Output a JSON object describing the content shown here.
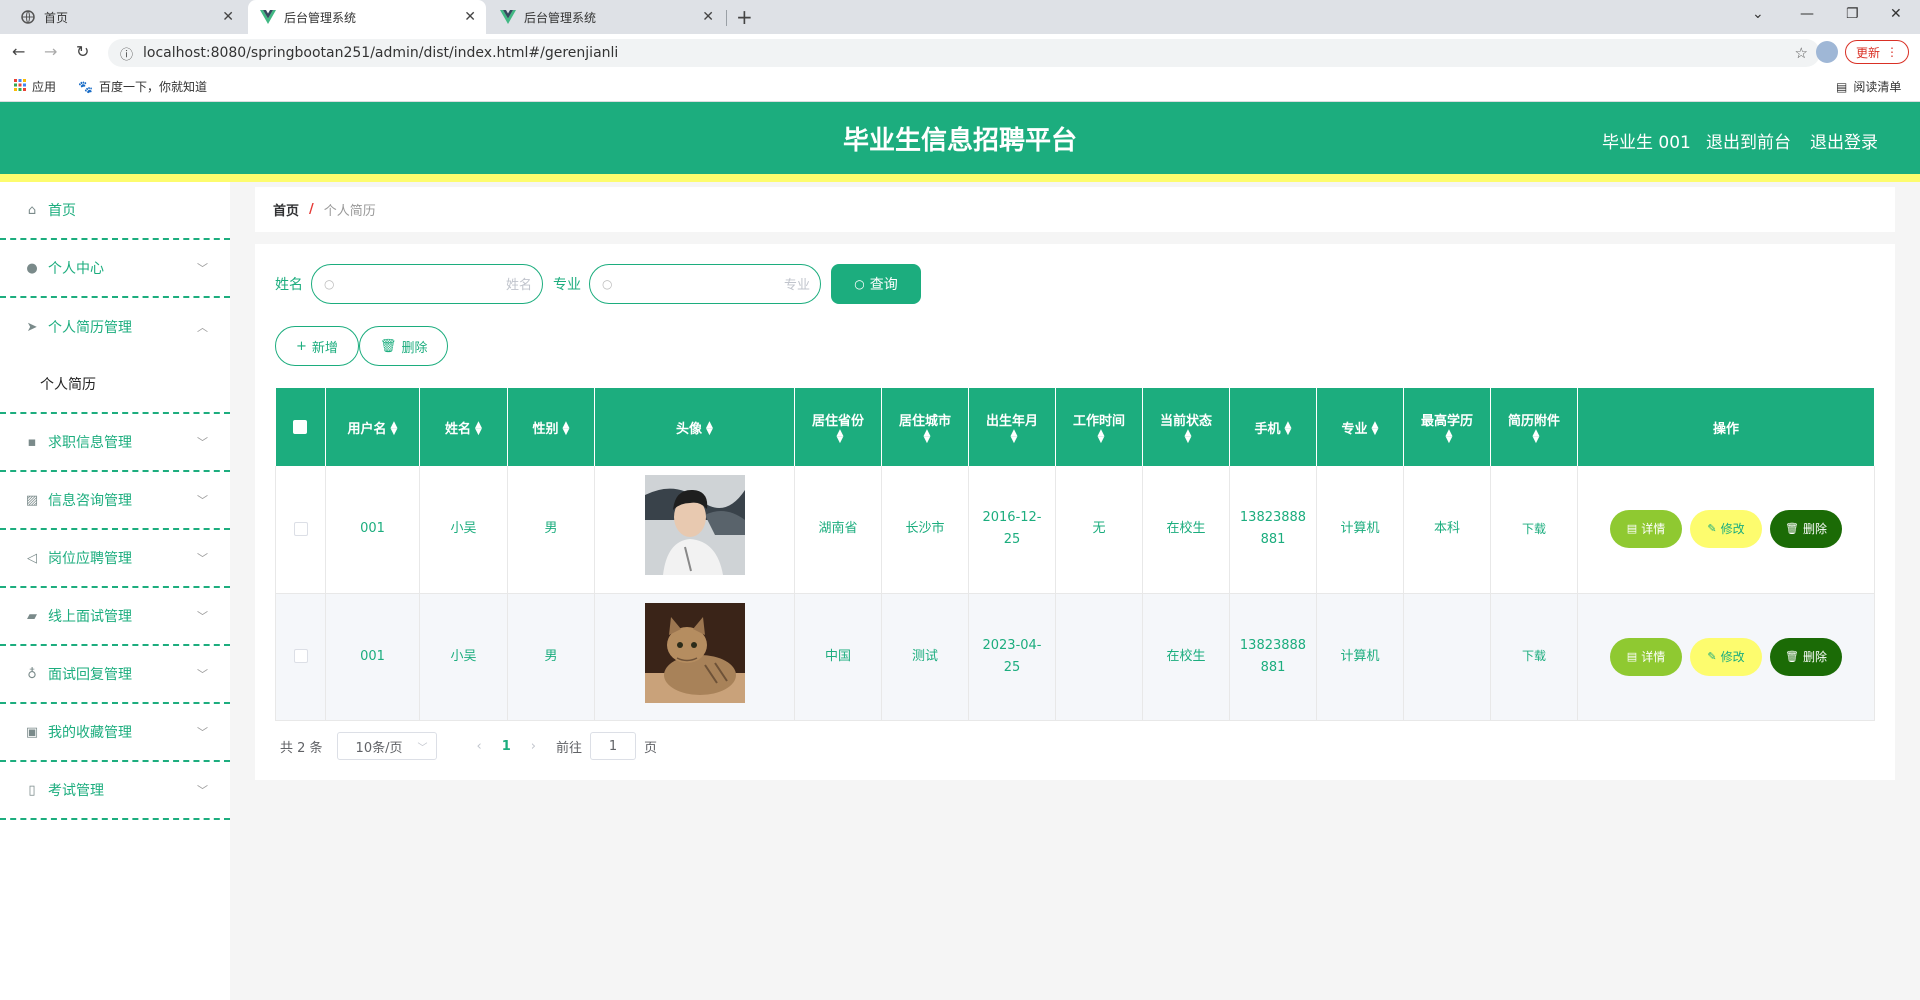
{
  "browser": {
    "tabs": [
      {
        "label": "首页"
      },
      {
        "label": "后台管理系统"
      },
      {
        "label": "后台管理系统"
      }
    ],
    "url": "localhost:8080/springbootan251/admin/dist/index.html#/gerenjianli",
    "update_label": "更新",
    "bookmarks": [
      {
        "label": "应用"
      },
      {
        "label": "百度一下，你就知道"
      },
      {
        "label": "阅读清单"
      }
    ]
  },
  "header": {
    "title": "毕业生信息招聘平台",
    "user": "毕业生 001",
    "to_front": "退出到前台",
    "logout": "退出登录"
  },
  "sidebar": {
    "items": [
      {
        "label": "首页",
        "icon": "home-icon"
      },
      {
        "label": "个人中心",
        "icon": "user-icon"
      },
      {
        "label": "个人简历管理",
        "icon": "send-icon"
      },
      {
        "label": "求职信息管理",
        "icon": "chat-icon"
      },
      {
        "label": "信息咨询管理",
        "icon": "chart-icon"
      },
      {
        "label": "岗位应聘管理",
        "icon": "position-icon"
      },
      {
        "label": "线上面试管理",
        "icon": "wallet-icon"
      },
      {
        "label": "面试回复管理",
        "icon": "microphone-icon"
      },
      {
        "label": "我的收藏管理",
        "icon": "suitcase-icon"
      },
      {
        "label": "考试管理",
        "icon": "phone-icon"
      }
    ],
    "submenu_label": "个人简历"
  },
  "breadcrumb": {
    "home": "首页",
    "sep": "/",
    "current": "个人简历"
  },
  "search": {
    "name_label": "姓名",
    "name_placeholder": "姓名",
    "major_label": "专业",
    "major_placeholder": "专业",
    "query_label": "查询"
  },
  "actions": {
    "add_label": "新增",
    "delete_label": "删除"
  },
  "table": {
    "columns": [
      "用户名",
      "姓名",
      "性别",
      "头像",
      "居住省份",
      "居住城市",
      "出生年月",
      "工作时间",
      "当前状态",
      "手机",
      "专业",
      "最高学历",
      "简历附件",
      "操作"
    ],
    "rows": [
      {
        "username": "001",
        "name": "小吴",
        "gender": "男",
        "province": "湖南省",
        "city": "长沙市",
        "birth_a": "2016-12-",
        "birth_b": "25",
        "work_time": "无",
        "status": "在校生",
        "phone_a": "13823888",
        "phone_b": "881",
        "major": "计算机",
        "education": "本科",
        "attachment": "下载"
      },
      {
        "username": "001",
        "name": "小吴",
        "gender": "男",
        "province": "中国",
        "city": "测试",
        "birth_a": "2023-04-",
        "birth_b": "25",
        "work_time": "",
        "status": "在校生",
        "phone_a": "13823888",
        "phone_b": "881",
        "major": "计算机",
        "education": "",
        "attachment": "下载"
      }
    ],
    "op_detail": "详情",
    "op_edit": "修改",
    "op_delete": "删除"
  },
  "pager": {
    "total": "共 2 条",
    "page_size": "10条/页",
    "current": "1",
    "goto_label": "前往",
    "goto_value": "1",
    "page_suffix": "页"
  },
  "colors": {
    "primary": "#1cad7e",
    "accent_yellow": "#fdfc6e",
    "detail_green": "#8fc931",
    "delete_dark": "#1b6b06"
  }
}
